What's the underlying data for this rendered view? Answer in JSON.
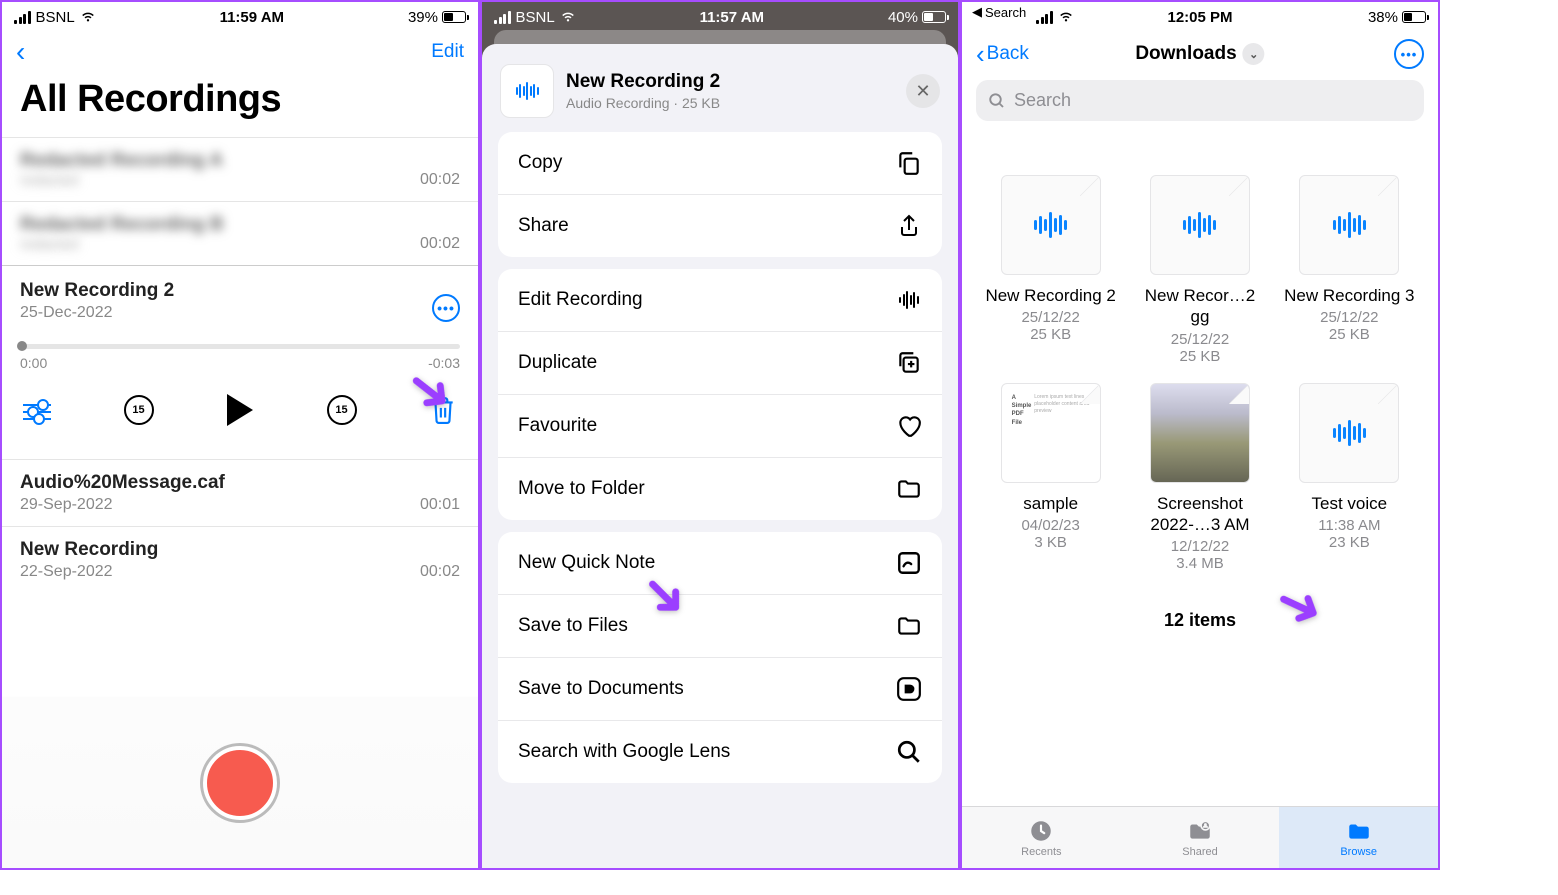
{
  "s1": {
    "status": {
      "carrier": "BSNL",
      "time": "11:59 AM",
      "battery": "39%",
      "fill": "39%"
    },
    "edit": "Edit",
    "title": "All Recordings",
    "blur1": {
      "name": "Redacted Recording A",
      "date": "redacted",
      "dur": "00:02"
    },
    "blur2": {
      "name": "Redacted Recording B",
      "date": "redacted",
      "dur": "00:02"
    },
    "sel": {
      "name": "New Recording 2",
      "date": "25-Dec-2022",
      "start": "0:00",
      "end": "-0:03",
      "skip": "15"
    },
    "r4": {
      "name": "Audio%20Message.caf",
      "date": "29-Sep-2022",
      "dur": "00:01"
    },
    "r5": {
      "name": "New Recording",
      "date": "22-Sep-2022",
      "dur": "00:02"
    }
  },
  "s2": {
    "status": {
      "carrier": "BSNL",
      "time": "11:57 AM",
      "battery": "40%",
      "fill": "40%"
    },
    "header": {
      "name": "New Recording 2",
      "sub": "Audio Recording · 25 KB"
    },
    "m": {
      "copy": "Copy",
      "share": "Share",
      "edit": "Edit Recording",
      "dup": "Duplicate",
      "fav": "Favourite",
      "move": "Move to Folder",
      "qnote": "New Quick Note",
      "save": "Save to Files",
      "docs": "Save to Documents",
      "lens": "Search with Google Lens"
    }
  },
  "s3": {
    "status": {
      "time": "12:05 PM",
      "battery": "38%",
      "fill": "38%",
      "breadcrumb": "Search"
    },
    "back": "Back",
    "title": "Downloads",
    "search": "Search",
    "files": [
      {
        "name": "New Recording 2",
        "date": "25/12/22",
        "size": "25 KB",
        "type": "audio"
      },
      {
        "name": "New Recor…2 gg",
        "date": "25/12/22",
        "size": "25 KB",
        "type": "audio"
      },
      {
        "name": "New Recording 3",
        "date": "25/12/22",
        "size": "25 KB",
        "type": "audio"
      },
      {
        "name": "sample",
        "date": "04/02/23",
        "size": "3 KB",
        "type": "pdf"
      },
      {
        "name": "Screenshot 2022-…3 AM",
        "date": "12/12/22",
        "size": "3.4 MB",
        "type": "img"
      },
      {
        "name": "Test voice",
        "date": "11:38 AM",
        "size": "23 KB",
        "type": "audio"
      }
    ],
    "count": "12 items",
    "tabs": {
      "recents": "Recents",
      "shared": "Shared",
      "browse": "Browse"
    }
  }
}
